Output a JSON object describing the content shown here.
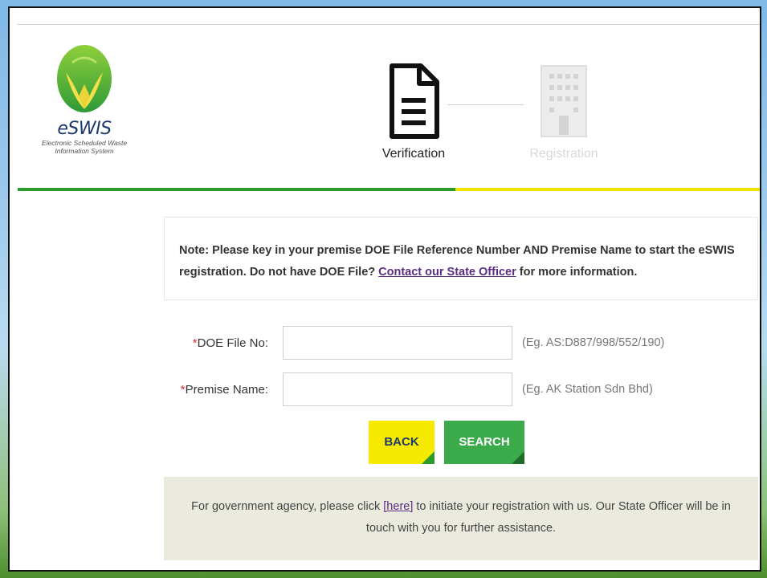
{
  "brand": {
    "name": "eSWIS",
    "subtitle_line1": "Electronic Scheduled Waste",
    "subtitle_line2": "Information System"
  },
  "steps": [
    {
      "label": "Verification",
      "icon": "document-icon",
      "active": true
    },
    {
      "label": "Registration",
      "icon": "building-icon",
      "active": false
    }
  ],
  "progress": {
    "completed_fraction": 0.59,
    "done_color": "#2d9a2d",
    "todo_color": "#f2e300"
  },
  "note": {
    "text_before": "Note: Please key in your premise DOE File Reference Number AND Premise Name to start the eSWIS registration. Do not have DOE File? ",
    "link": "Contact our State Officer",
    "text_after": " for more information."
  },
  "form": {
    "doe": {
      "required": "*",
      "label": "DOE File No:",
      "value": "",
      "hint": "(Eg. AS:D887/998/552/190)"
    },
    "premise": {
      "required": "*",
      "label": "Premise Name:",
      "value": "",
      "hint": "(Eg. AK Station Sdn Bhd)"
    }
  },
  "buttons": {
    "back": "BACK",
    "search": "SEARCH"
  },
  "gov": {
    "text_before": "For government agency, please click ",
    "link": "[here]",
    "text_after": " to initiate your registration with us. Our State Officer will be in touch with you for further assistance."
  },
  "colors": {
    "brand_navy": "#1f3a6e",
    "accent_green": "#3aaa4a",
    "accent_yellow": "#f5ea00",
    "link_purple": "#5b2d82"
  }
}
